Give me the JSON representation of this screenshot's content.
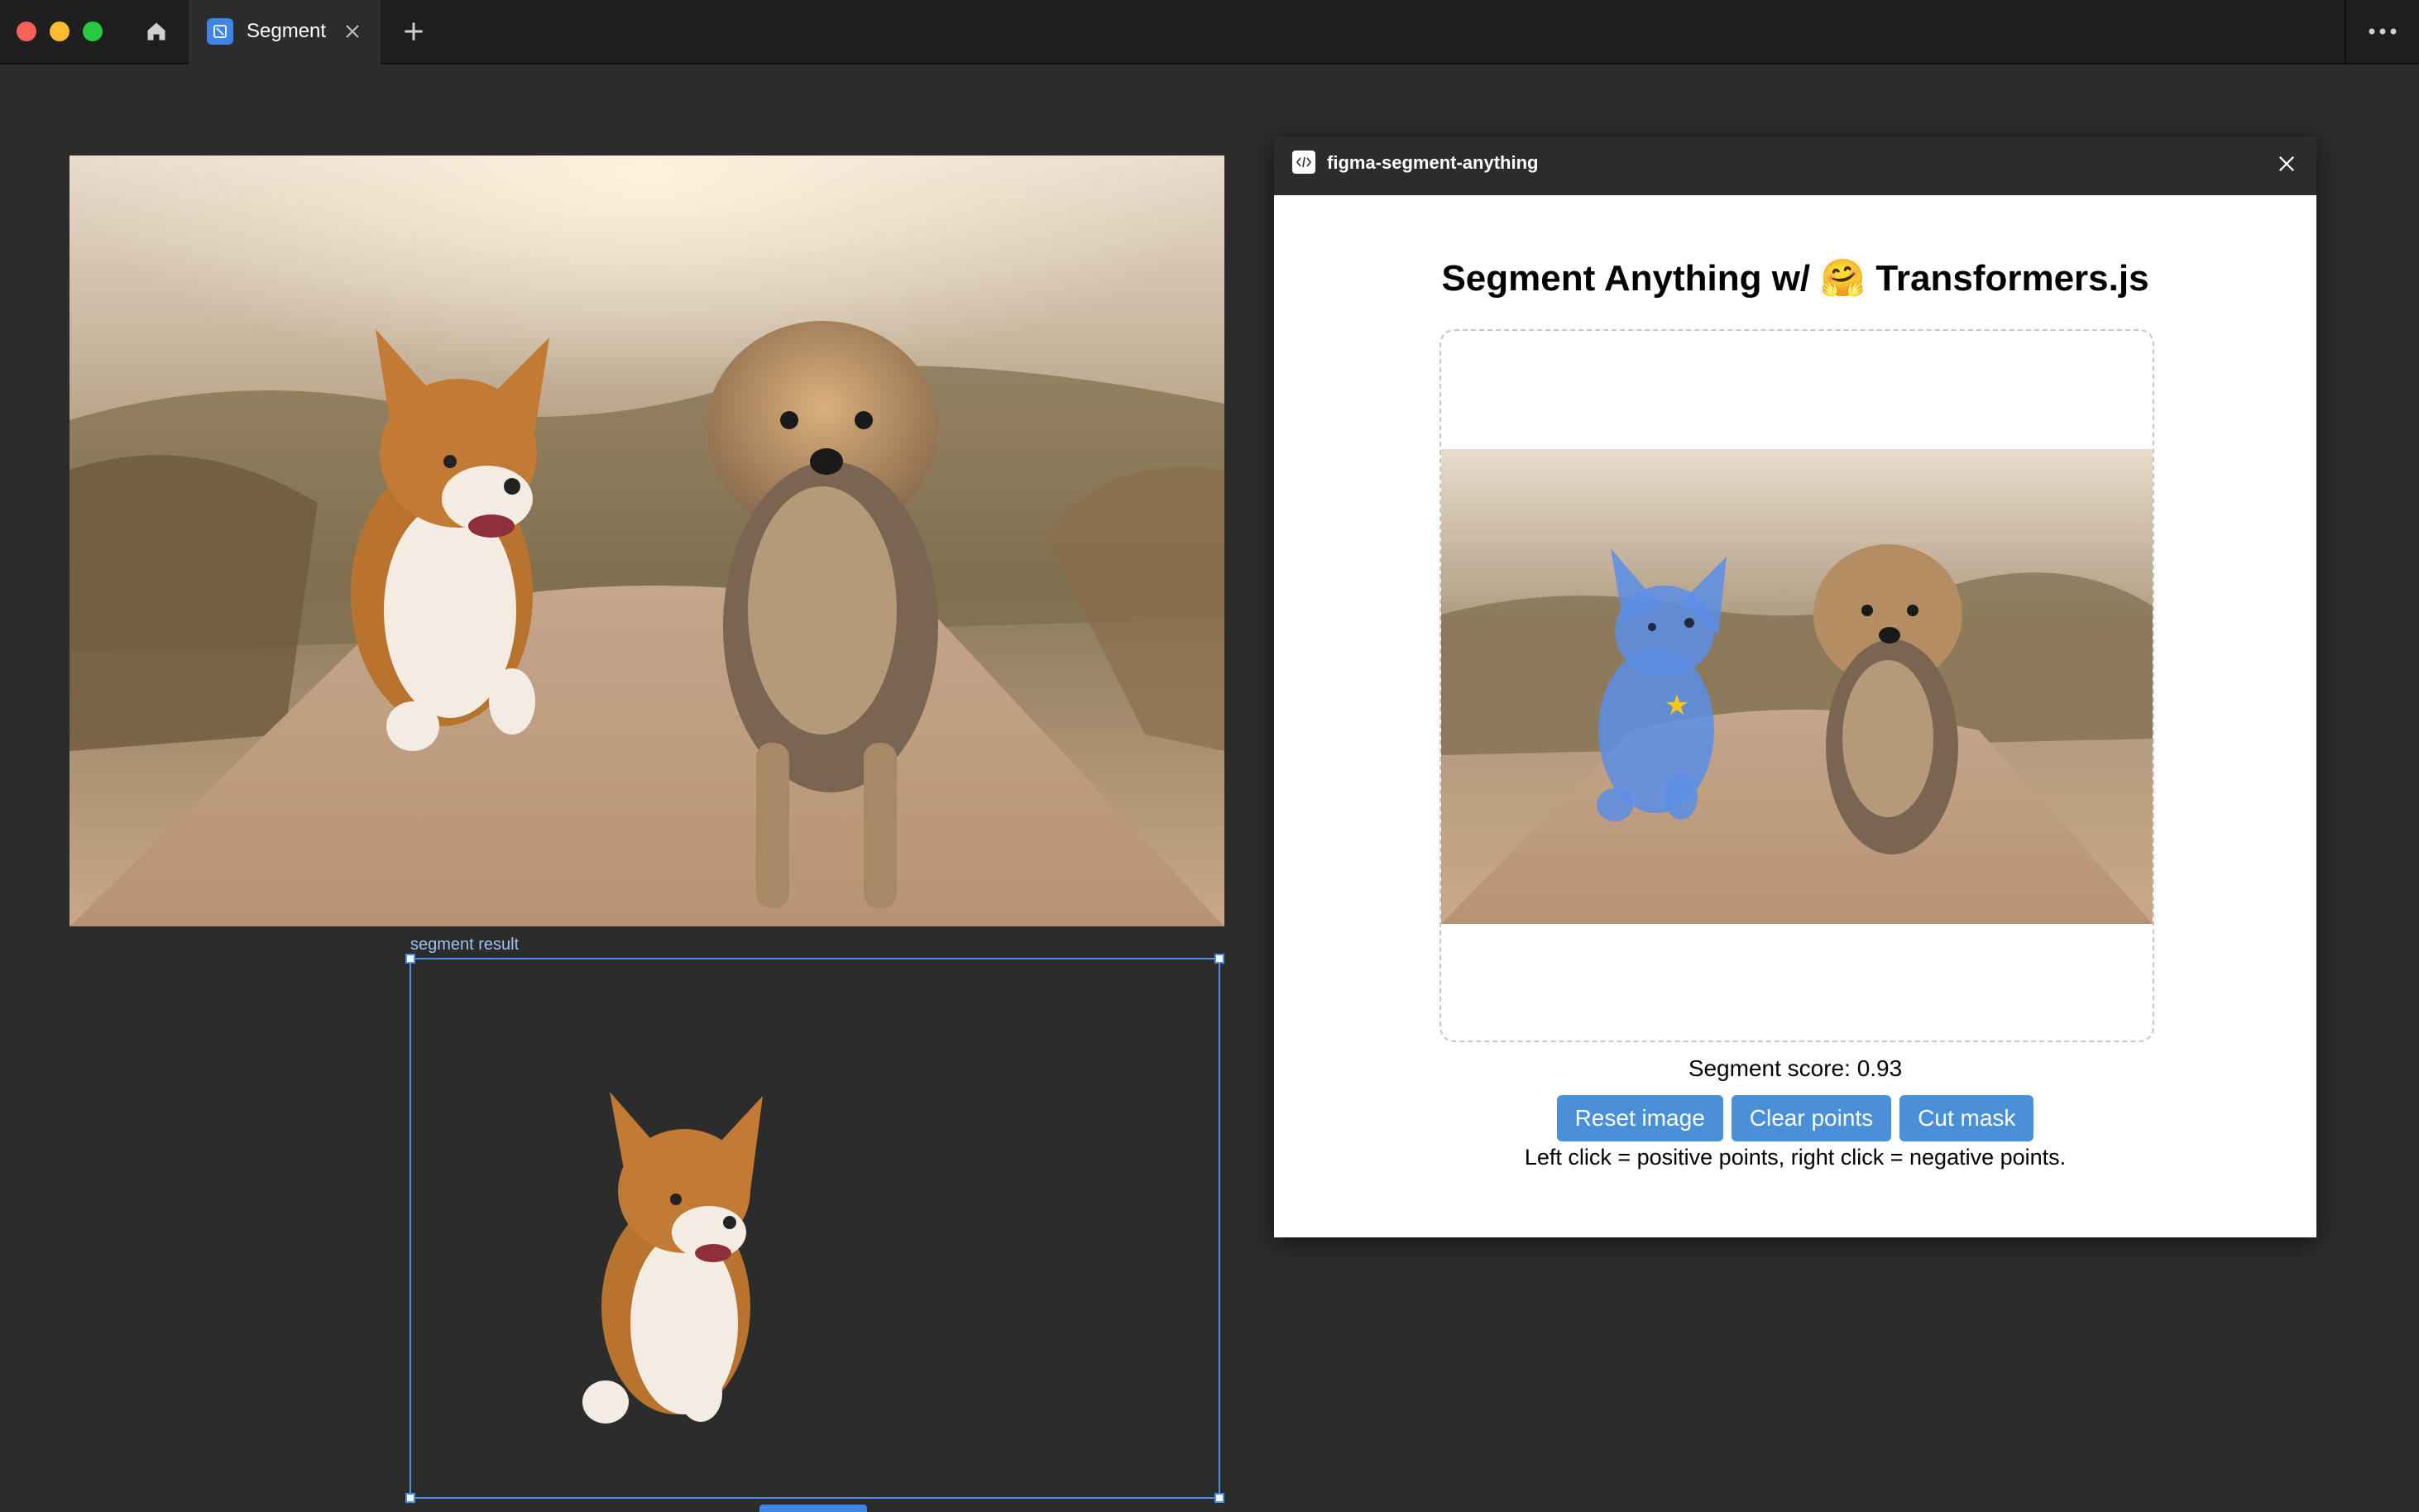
{
  "titlebar": {
    "tab_label": "Segment",
    "icons": [
      "home-icon",
      "close-icon",
      "plus-icon",
      "more-icon"
    ]
  },
  "canvas": {
    "frame_label": "segment result"
  },
  "plugin": {
    "title": "figma-segment-anything",
    "heading_prefix": "Segment Anything w/ ",
    "heading_emoji": "🤗",
    "heading_suffix": " Transformers.js",
    "score_text": "Segment score: 0.93",
    "buttons": {
      "reset": "Reset image",
      "clear": "Clear points",
      "cut": "Cut mask"
    },
    "hint": "Left click = positive points, right click = negative points.",
    "point_marker": "★"
  },
  "colors": {
    "accent": "#4a90d9",
    "selection": "#4a90e2",
    "mask": "#5a8ee6",
    "point": "#f5c518"
  }
}
